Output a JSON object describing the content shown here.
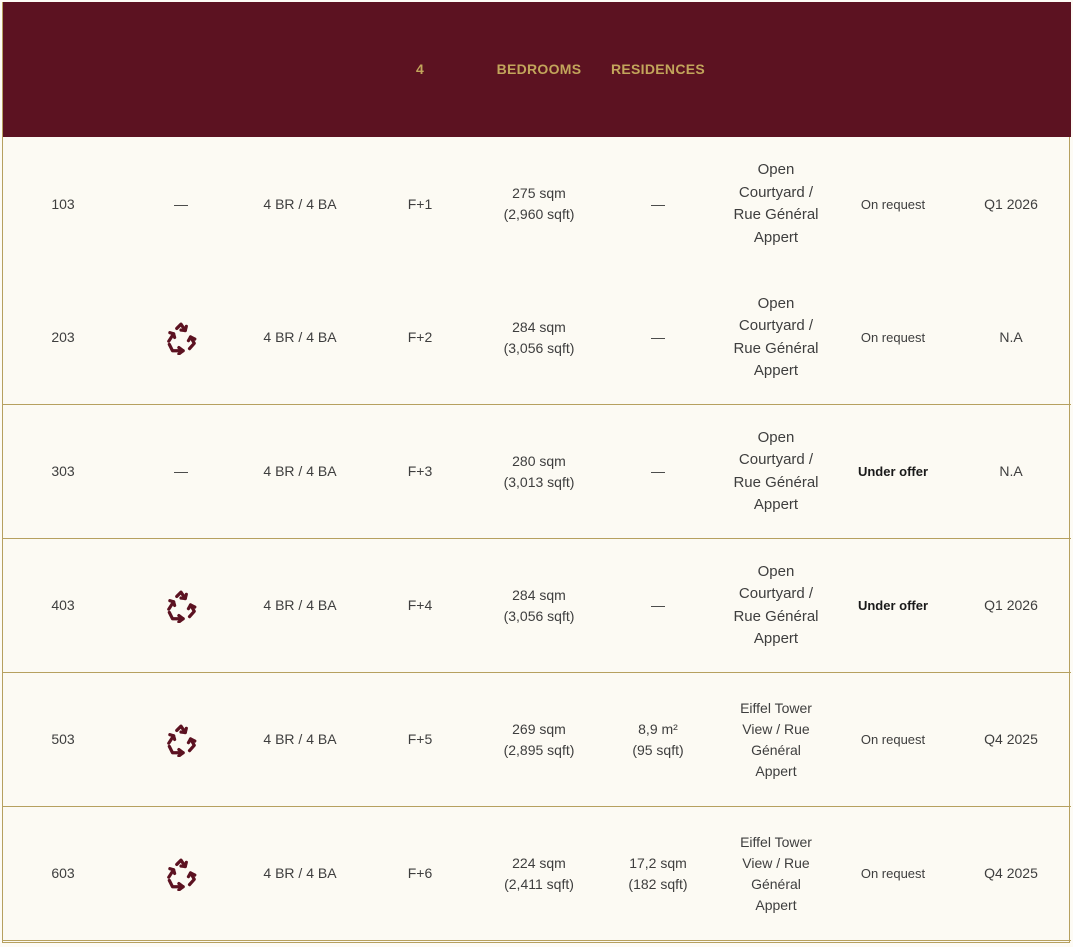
{
  "header": {
    "col_floor": "4",
    "col_area": "BEDROOMS",
    "col_terrace": "RESIDENCES"
  },
  "icons": {
    "renovation": "recycle-icon",
    "none": "—"
  },
  "colors": {
    "header_bg": "#5c1221",
    "accent_gold": "#c2a55b",
    "icon": "#5c1221"
  },
  "rows": [
    {
      "unit": "103",
      "icon": "—",
      "bedrooms": "4 BR / 4 BA",
      "floor": "F+1",
      "area_sqm": "275 sqm",
      "area_sqft": "(2,960 sqft)",
      "terrace": "—",
      "terrace_sqft": "",
      "view": [
        "Open",
        "Courtyard /",
        "Rue Général",
        "Appert"
      ],
      "status": "On request",
      "delivery": "Q1 2026"
    },
    {
      "unit": "203",
      "icon": "recycle-icon",
      "bedrooms": "4 BR / 4 BA",
      "floor": "F+2",
      "area_sqm": "284 sqm",
      "area_sqft": "(3,056 sqft)",
      "terrace": "—",
      "terrace_sqft": "",
      "view": [
        "Open",
        "Courtyard /",
        "Rue Général",
        "Appert"
      ],
      "status": "On request",
      "delivery": "N.A"
    },
    {
      "unit": "303",
      "icon": "—",
      "bedrooms": "4 BR / 4 BA",
      "floor": "F+3",
      "area_sqm": "280 sqm",
      "area_sqft": "(3,013 sqft)",
      "terrace": "—",
      "terrace_sqft": "",
      "view": [
        "Open",
        "Courtyard /",
        "Rue Général",
        "Appert"
      ],
      "status": "Under offer",
      "delivery": "N.A"
    },
    {
      "unit": "403",
      "icon": "recycle-icon",
      "bedrooms": "4 BR / 4 BA",
      "floor": "F+4",
      "area_sqm": "284 sqm",
      "area_sqft": "(3,056 sqft)",
      "terrace": "—",
      "terrace_sqft": "",
      "view": [
        "Open",
        "Courtyard /",
        "Rue Général",
        "Appert"
      ],
      "status": "Under offer",
      "delivery": "Q1 2026"
    },
    {
      "unit": "503",
      "icon": "recycle-icon",
      "bedrooms": "4 BR / 4 BA",
      "floor": "F+5",
      "area_sqm": "269 sqm",
      "area_sqft": "(2,895 sqft)",
      "terrace": "8,9 m²",
      "terrace_sqft": "(95 sqft)",
      "view": [
        "Eiffel Tower",
        "View / Rue",
        "Général",
        "Appert"
      ],
      "status": "On request",
      "delivery": "Q4 2025"
    },
    {
      "unit": "603",
      "icon": "recycle-icon",
      "bedrooms": "4 BR / 4 BA",
      "floor": "F+6",
      "area_sqm": "224 sqm",
      "area_sqft": "(2,411 sqft)",
      "terrace": "17,2 sqm",
      "terrace_sqft": "(182 sqft)",
      "view": [
        "Eiffel Tower",
        "View / Rue",
        "Général",
        "Appert"
      ],
      "status": "On request",
      "delivery": "Q4 2025"
    }
  ]
}
